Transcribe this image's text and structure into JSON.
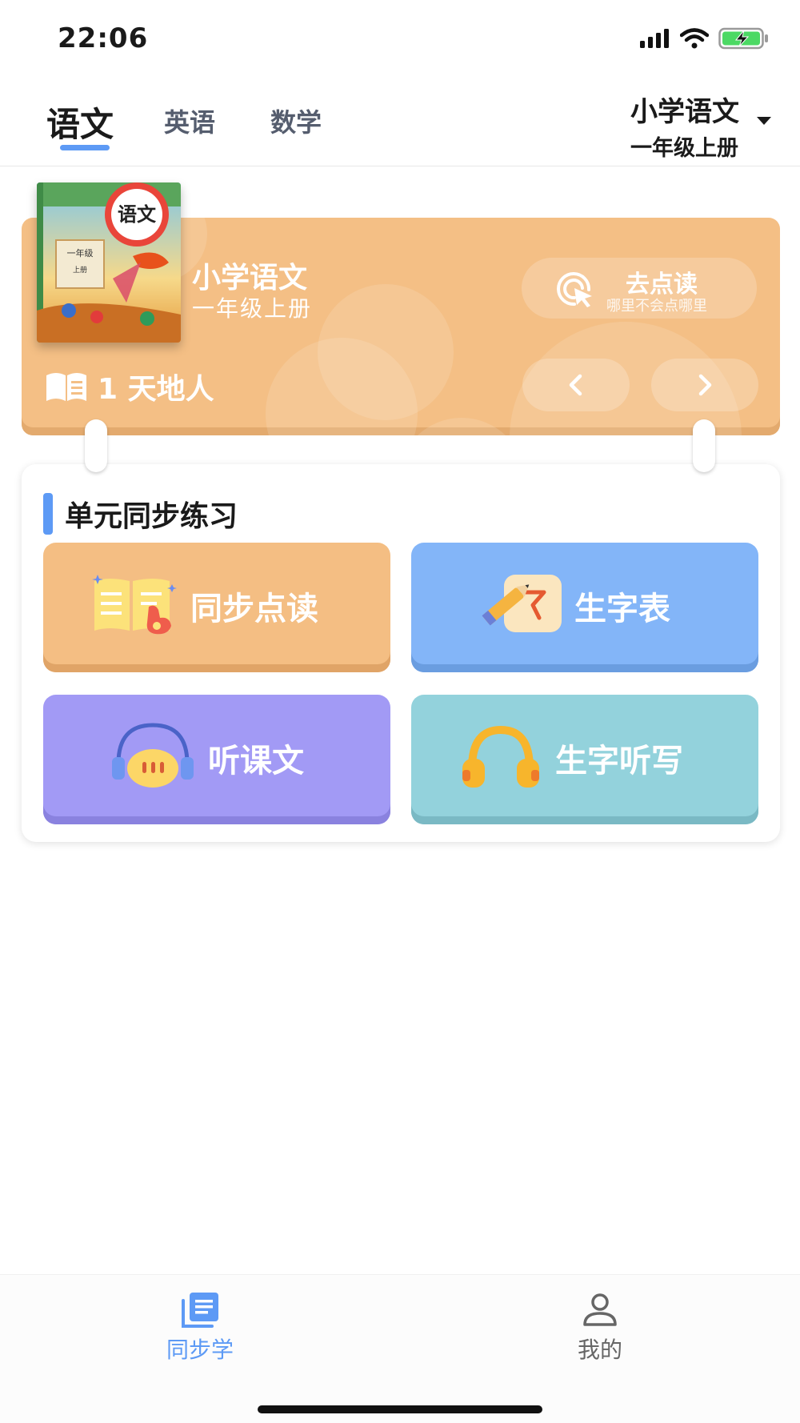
{
  "status_bar": {
    "time": "22:06",
    "icons": [
      "signal-icon",
      "wifi-icon",
      "battery-charging-icon"
    ]
  },
  "subject_tabs": [
    {
      "label": "语文",
      "active": true
    },
    {
      "label": "英语",
      "active": false
    },
    {
      "label": "数学",
      "active": false
    }
  ],
  "book_selector": {
    "title": "小学语文",
    "subtitle": "一年级上册"
  },
  "banner": {
    "cover": {
      "title_art": "语文",
      "grade": "一年级",
      "volume": "上册"
    },
    "book_title": "小学语文",
    "book_subtitle": "一年级上册",
    "point_read": {
      "label": "去点读",
      "hint": "哪里不会点哪里"
    },
    "current_lesson": "1 天地人"
  },
  "practice": {
    "title": "单元同步练习",
    "tiles": [
      {
        "label": "同步点读",
        "icon": "book-pointer-icon",
        "color": "#f4be83"
      },
      {
        "label": "生字表",
        "icon": "character-pencil-icon",
        "color": "#83b5f8"
      },
      {
        "label": "听课文",
        "icon": "headphones-speech-icon",
        "color": "#a29af5"
      },
      {
        "label": "生字听写",
        "icon": "headphones-icon",
        "color": "#93d2dc"
      }
    ]
  },
  "bottom_nav": [
    {
      "label": "同步学",
      "icon": "book-stack-icon",
      "active": true
    },
    {
      "label": "我的",
      "icon": "user-icon",
      "active": false
    }
  ],
  "colors": {
    "accent": "#5d9af5",
    "banner": "#f4bf85",
    "inactive_nav": "#666666"
  }
}
